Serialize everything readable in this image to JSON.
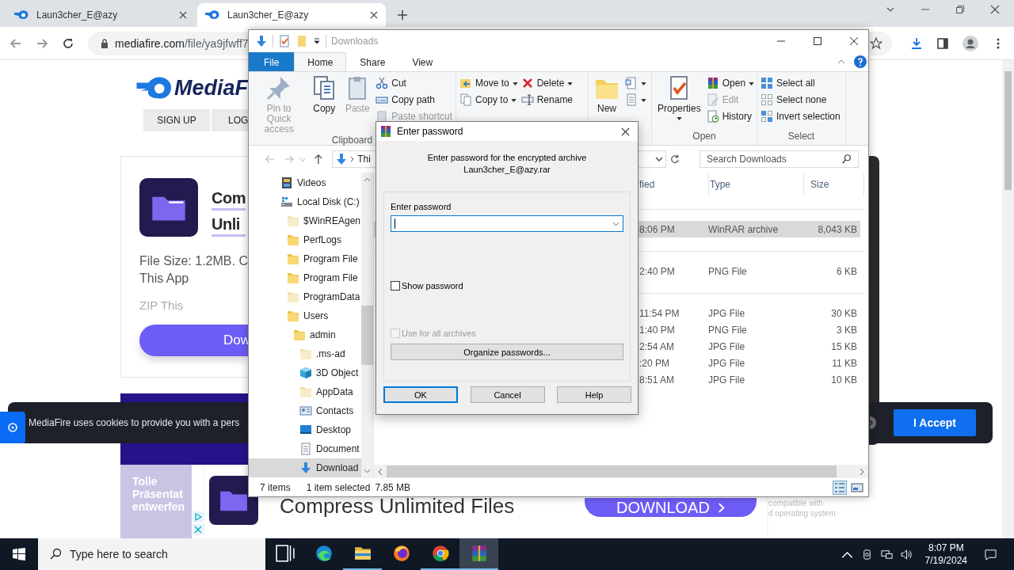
{
  "browser": {
    "tabs": [
      {
        "title": "Laun3cher_E@azy",
        "selected": false
      },
      {
        "title": "Laun3cher_E@azy",
        "selected": true
      }
    ],
    "url_host": "mediafire.com",
    "url_path": "/file/ya9jfwff7"
  },
  "page": {
    "logo": "MediaF",
    "nav_buttons": [
      "SIGN UP",
      "LOG"
    ],
    "card": {
      "title_lines": [
        "Com",
        "Unli"
      ],
      "info_lines": [
        "File Size: 1.2MB. C",
        "This App"
      ],
      "note": "ZIP This",
      "button": "Dow"
    },
    "cookie": {
      "text": "MediaFire uses cookies to provide you with a pers",
      "button": "I Accept"
    },
    "ad": {
      "side_lines": [
        "Tolle",
        "Präsentat",
        "entwerfen"
      ],
      "headline": "Compress Unlimited Files",
      "button": "DOWNLOAD",
      "note_lines": [
        "compatible with",
        "d operating system"
      ]
    }
  },
  "explorer": {
    "title": "Downloads",
    "ribbon_tabs": [
      {
        "label": "File",
        "kind": "file",
        "selected": false
      },
      {
        "label": "Home",
        "kind": "tab",
        "selected": true
      },
      {
        "label": "Share",
        "kind": "tab",
        "selected": false
      },
      {
        "label": "View",
        "kind": "tab",
        "selected": false
      }
    ],
    "ribbon_groups": [
      {
        "label": "Clipboard",
        "columns": [
          [
            {
              "kind": "large",
              "label": "Pin to Quick access",
              "disabled": true
            }
          ],
          [
            {
              "kind": "large",
              "label": "Copy",
              "disabled": false
            }
          ],
          [
            {
              "kind": "large",
              "label": "Paste",
              "disabled": true
            }
          ],
          [
            {
              "kind": "small",
              "label": "Cut",
              "disabled": false
            },
            {
              "kind": "small",
              "label": "Copy path",
              "disabled": false
            },
            {
              "kind": "small",
              "label": "Paste shortcut",
              "disabled": true
            }
          ]
        ]
      },
      {
        "columns": [
          [
            {
              "kind": "small",
              "label": "Move to",
              "disabled": false,
              "dropdown": true
            },
            {
              "kind": "small",
              "label": "Copy to",
              "disabled": false,
              "dropdown": true
            }
          ],
          [
            {
              "kind": "small",
              "label": "Delete",
              "disabled": false,
              "dropdown": true
            },
            {
              "kind": "small",
              "label": "Rename",
              "disabled": false
            }
          ]
        ]
      },
      {
        "columns": [
          [
            {
              "kind": "large",
              "label": "New",
              "disabled": false
            }
          ],
          [
            {
              "kind": "small",
              "dropdown": true
            },
            {
              "kind": "small",
              "dropdown": true
            }
          ]
        ]
      },
      {
        "label": "Open",
        "columns": [
          [
            {
              "kind": "large",
              "label": "Properties",
              "disabled": false,
              "dropdown": true
            }
          ],
          [
            {
              "kind": "small",
              "label": "Open",
              "disabled": false,
              "dropdown": true
            },
            {
              "kind": "small",
              "label": "Edit",
              "disabled": true
            },
            {
              "kind": "small",
              "label": "History",
              "disabled": false
            }
          ]
        ]
      },
      {
        "label": "Select",
        "columns": [
          [
            {
              "kind": "small",
              "label": "Select all",
              "disabled": false
            },
            {
              "kind": "small",
              "label": "Select none",
              "disabled": false
            },
            {
              "kind": "small",
              "label": "Invert selection",
              "disabled": false
            }
          ]
        ]
      }
    ],
    "address": "Thi",
    "search": {
      "placeholder": "Search Downloads"
    },
    "tree": [
      {
        "label": "Videos",
        "kind": "videos",
        "selected": false
      },
      {
        "label": "Local Disk (C:)",
        "kind": "drive",
        "selected": false,
        "children": [
          {
            "label": "$WinREAgen",
            "kind": "hidden-folder",
            "selected": false
          },
          {
            "label": "PerfLogs",
            "kind": "folder",
            "selected": false
          },
          {
            "label": "Program File",
            "kind": "folder",
            "selected": false
          },
          {
            "label": "Program File",
            "kind": "folder",
            "selected": false
          },
          {
            "label": "ProgramData",
            "kind": "hidden-folder",
            "selected": false
          },
          {
            "label": "Users",
            "kind": "folder",
            "selected": false,
            "children": [
              {
                "label": "admin",
                "kind": "folder",
                "selected": false,
                "children": [
                  {
                    "label": ".ms-ad",
                    "kind": "hidden-folder",
                    "selected": false
                  },
                  {
                    "label": "3D Object",
                    "kind": "cube",
                    "selected": false
                  },
                  {
                    "label": "AppData",
                    "kind": "hidden-folder",
                    "selected": false
                  },
                  {
                    "label": "Contacts",
                    "kind": "contacts",
                    "selected": false
                  },
                  {
                    "label": "Desktop",
                    "kind": "desktop",
                    "selected": false
                  },
                  {
                    "label": "Document",
                    "kind": "documents",
                    "selected": false
                  },
                  {
                    "label": "Download",
                    "kind": "downloads",
                    "selected": true
                  }
                ]
              }
            ]
          }
        ]
      }
    ],
    "columns": [
      "fied",
      "Type",
      "Size"
    ],
    "groups": [
      {
        "rows": [
          {
            "date": "8:06 PM",
            "type": "WinRAR archive",
            "size": "8,043 KB",
            "selected": true
          }
        ]
      },
      {
        "rows": [
          {
            "date": "2:40 PM",
            "type": "PNG File",
            "size": "6 KB",
            "selected": false
          }
        ]
      },
      {
        "rows": [
          {
            "date": "11:54 PM",
            "type": "JPG File",
            "size": "30 KB",
            "selected": false
          },
          {
            "date": "1:40 PM",
            "type": "PNG File",
            "size": "3 KB",
            "selected": false
          },
          {
            "date": "2:54 AM",
            "type": "JPG File",
            "size": "15 KB",
            "selected": false
          },
          {
            "date": ":20 PM",
            "type": "JPG File",
            "size": "11 KB",
            "selected": false
          },
          {
            "date": "8:51 AM",
            "type": "JPG File",
            "size": "10 KB",
            "selected": false
          }
        ]
      }
    ],
    "status": {
      "count": "7 items",
      "selection": "1 item selected",
      "size": "7.85 MB"
    }
  },
  "dialog": {
    "title": "Enter password",
    "message": "Enter password for the encrypted archive",
    "archive": "Laun3cher_E@azy.rar",
    "field_label": "Enter password",
    "show_password": {
      "label": "Show password",
      "checked": false
    },
    "use_for_all": {
      "label": "Use for all archives",
      "checked": false,
      "disabled": true
    },
    "organize_button": "Organize passwords...",
    "buttons": [
      {
        "label": "OK",
        "default": true
      },
      {
        "label": "Cancel",
        "default": false
      },
      {
        "label": "Help",
        "default": false
      }
    ]
  },
  "taskbar": {
    "search_placeholder": "Type here to search",
    "apps": [
      {
        "kind": "taskview",
        "running": false,
        "active": false
      },
      {
        "kind": "edge",
        "running": false,
        "active": false
      },
      {
        "kind": "explorer",
        "running": true,
        "active": false
      },
      {
        "kind": "firefox",
        "running": false,
        "active": false
      },
      {
        "kind": "chrome",
        "running": true,
        "active": false
      },
      {
        "kind": "winrar",
        "running": true,
        "active": true
      }
    ],
    "time": "8:07 PM",
    "date": "7/19/2024"
  }
}
